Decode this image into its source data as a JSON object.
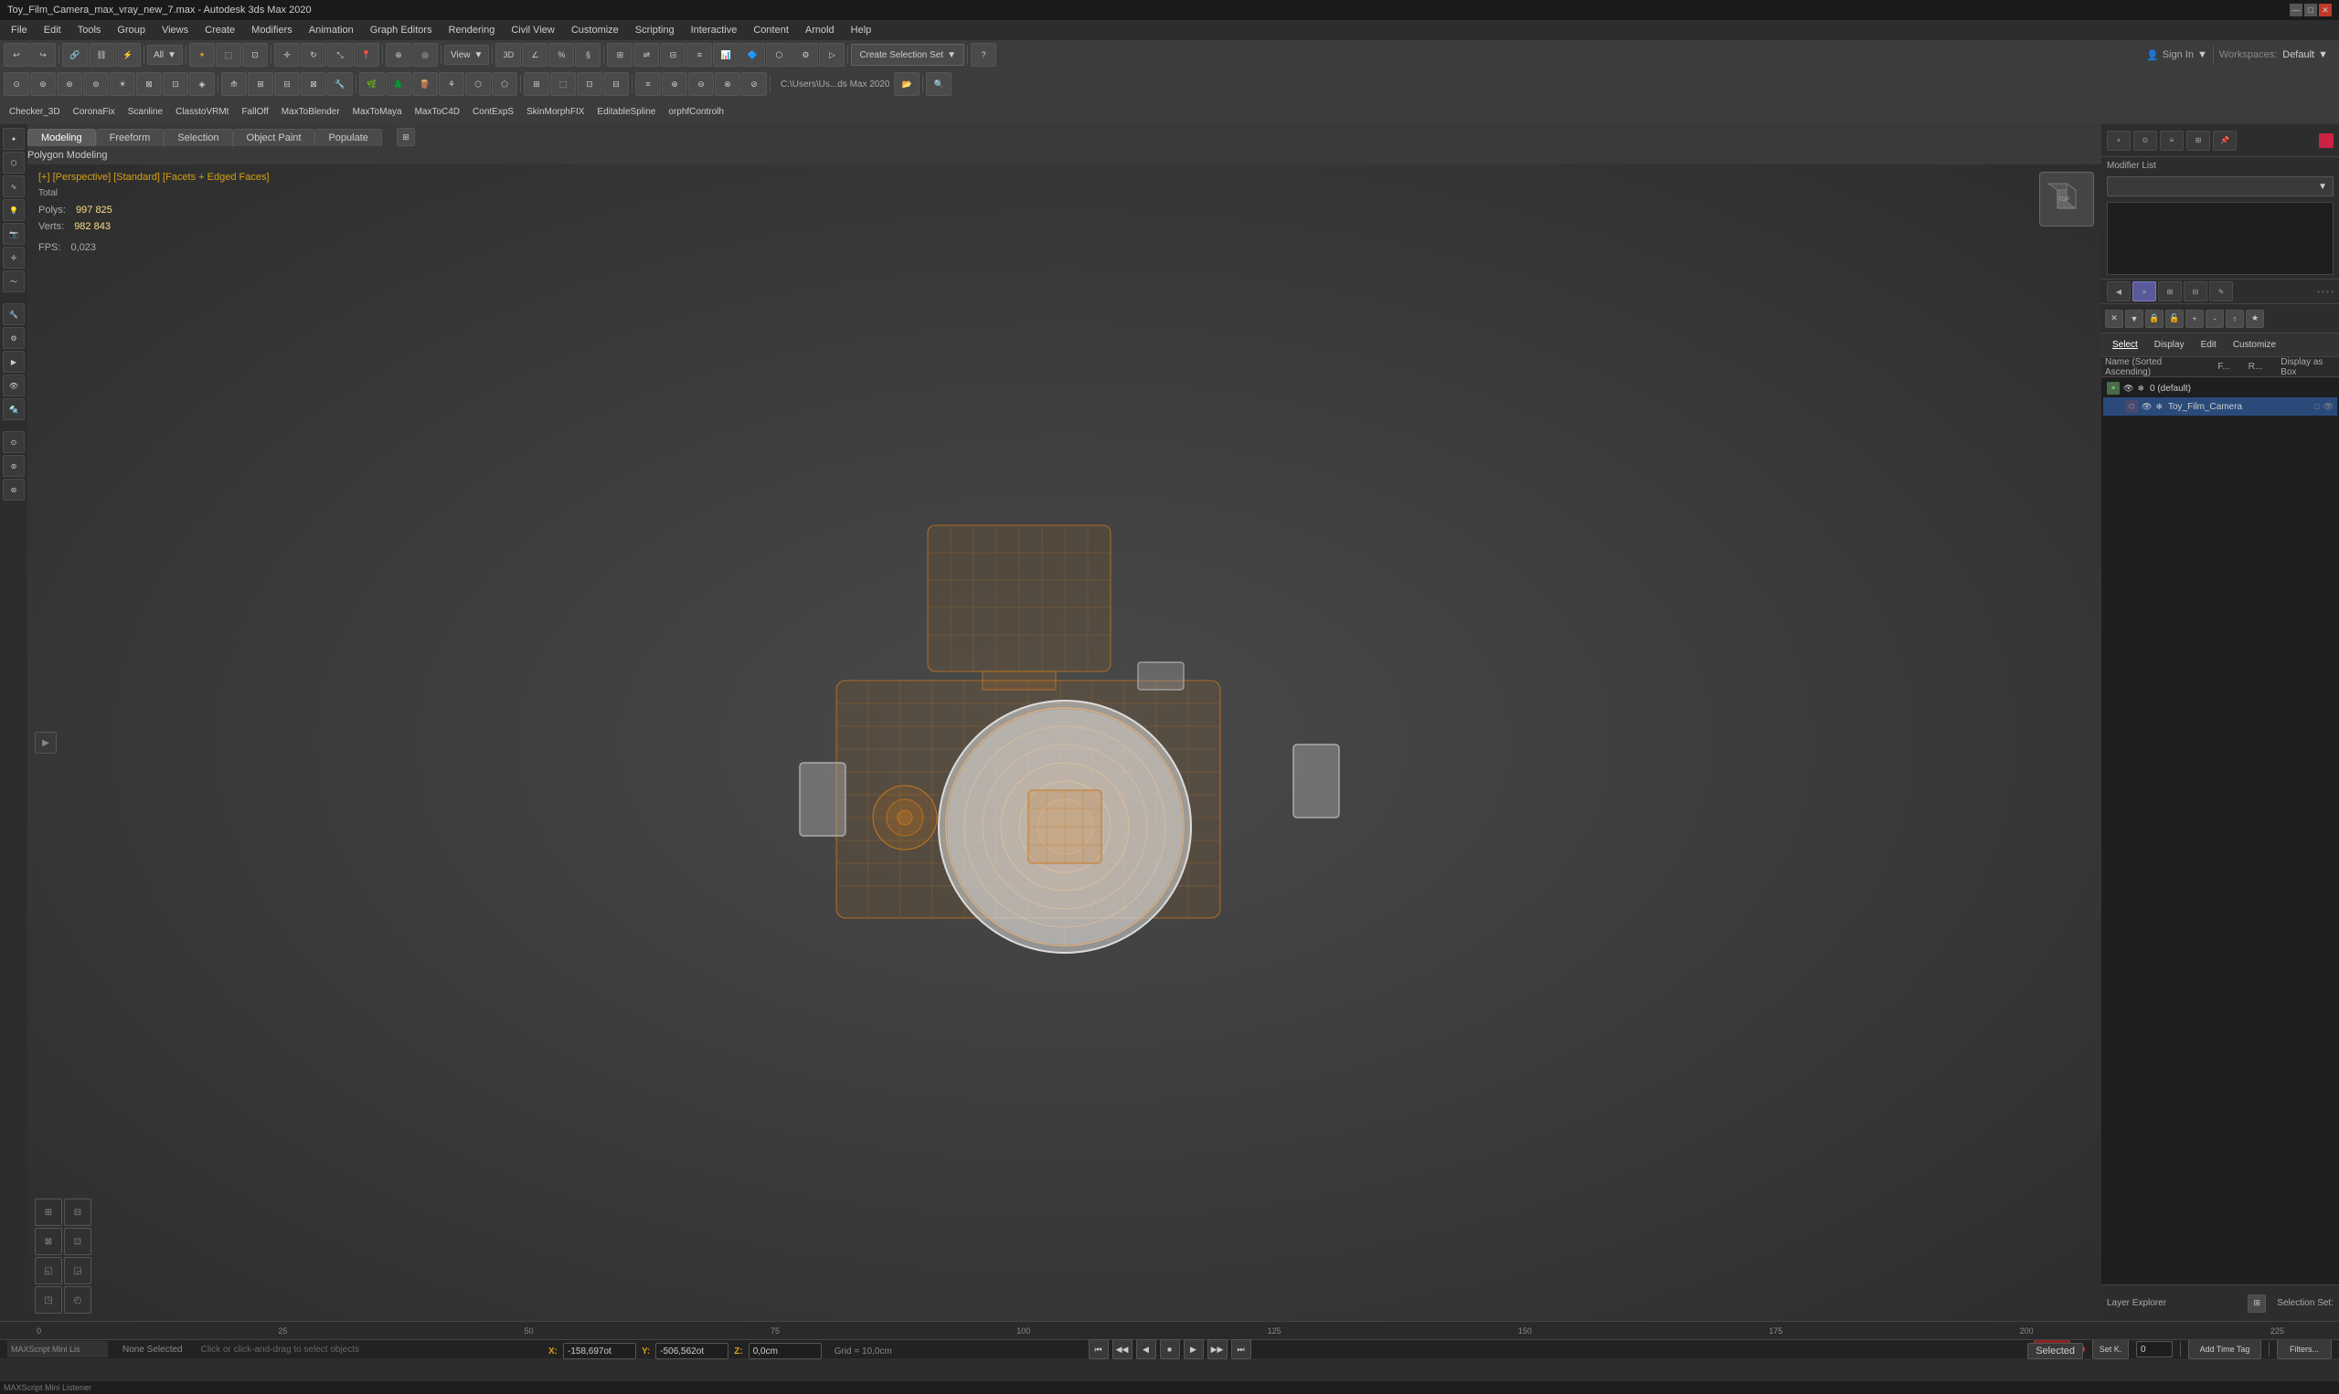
{
  "titlebar": {
    "title": "Toy_Film_Camera_max_vray_new_7.max - Autodesk 3ds Max 2020",
    "min_label": "—",
    "max_label": "□",
    "close_label": "✕"
  },
  "menu": {
    "items": [
      "File",
      "Edit",
      "Tools",
      "Group",
      "Views",
      "Create",
      "Modifiers",
      "Animation",
      "Graph Editors",
      "Rendering",
      "Civil View",
      "Customize",
      "Scripting",
      "Interactive",
      "Content",
      "Arnold",
      "Help"
    ]
  },
  "toolbar1": {
    "dropdown_all": "All",
    "view_label": "View",
    "create_selection_set": "Create Selection Set",
    "sign_in": "Sign In",
    "workspaces_label": "Workspaces:",
    "workspaces_value": "Default",
    "file_path": "C:\\Users\\Us...ds Max 2020"
  },
  "toolbar3": {
    "plugins": [
      "Checker_3D",
      "CoronaFix",
      "Scanline",
      "ClasstoVRMt",
      "FallOff",
      "MaxToBlender",
      "MaxToMaya",
      "MaxToC4D",
      "ContExpS",
      "SkinMorphFIX",
      "EditableSpline",
      "orphfControlh"
    ]
  },
  "tabs": {
    "items": [
      "Modeling",
      "Freeform",
      "Selection",
      "Object Paint",
      "Populate"
    ],
    "active": "Modeling"
  },
  "sub_header": {
    "text": "Polygon Modeling"
  },
  "viewport": {
    "label": "[+] [Perspective] [Standard] [Facets + Edged Faces]",
    "stats_title": "Total",
    "polys_label": "Polys:",
    "polys_value": "997 825",
    "verts_label": "Verts:",
    "verts_value": "982 843",
    "fps_label": "FPS:",
    "fps_value": "0,023"
  },
  "scene_explorer": {
    "tabs": [
      "Select",
      "Display",
      "Edit",
      "Customize"
    ],
    "active_tab": "Select",
    "columns": [
      "Name (Sorted Ascending)",
      "F...",
      "R...",
      "Display as Box"
    ],
    "items": [
      {
        "indent": 0,
        "icon": "layer",
        "name": "0 (default)",
        "type": "layer"
      },
      {
        "indent": 1,
        "icon": "mesh",
        "name": "Toy_Film_Camera",
        "type": "object",
        "selected": true
      }
    ]
  },
  "modifier_panel": {
    "modifier_list_label": "Modifier List",
    "color_swatch": "#cc2244"
  },
  "right_panel_tabs": {
    "items": [
      "◀",
      "≡",
      "⊞",
      "⊟",
      "✎"
    ],
    "active_index": 1
  },
  "coordinates": {
    "x_label": "X:",
    "x_value": "-158,697ot",
    "y_label": "Y:",
    "y_value": "-506,562ot",
    "z_label": "Z:",
    "z_value": "0,0cm",
    "grid_label": "Grid = 10,0cm"
  },
  "timeline": {
    "frame_current": "0",
    "frame_total": "225",
    "markers": [
      "0",
      "25",
      "50",
      "75",
      "100",
      "125",
      "150",
      "175",
      "200",
      "225"
    ],
    "frame_markers": [
      133,
      192,
      250,
      308,
      366,
      424,
      483,
      541,
      600,
      658
    ]
  },
  "playback": {
    "buttons": [
      "⏮",
      "◀◀",
      "◀",
      "⏹",
      "▶",
      "▶▶",
      "⏭"
    ],
    "auto_key_label": "Auto",
    "set_key_label": "Set K.",
    "key_filters_label": "Filters..."
  },
  "status": {
    "none_selected": "None Selected",
    "hint": "Click or click-and-drag to select objects",
    "selected_label": "Selected",
    "add_time_tag": "Add Time Tag"
  },
  "bottom": {
    "layer_explorer_label": "Layer Explorer",
    "selection_set_label": "Selection Set:",
    "maxscript_label": "MAXScript Mini Lis"
  }
}
